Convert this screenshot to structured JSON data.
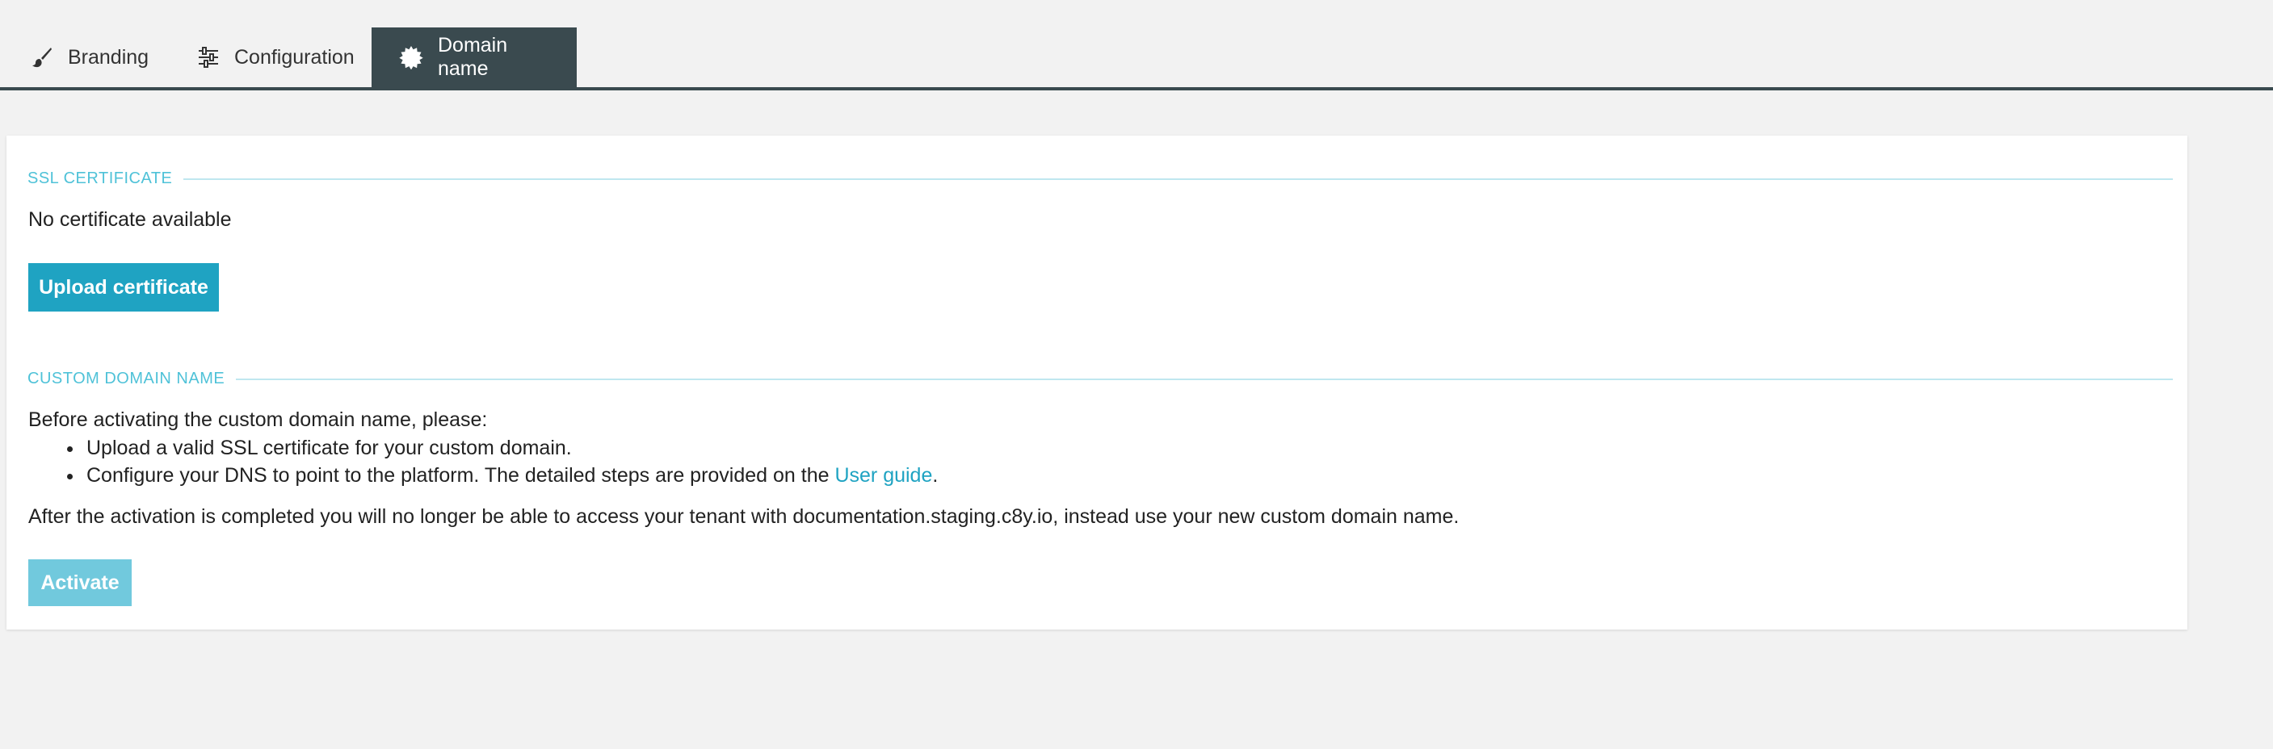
{
  "tabs": [
    {
      "label": "Branding",
      "icon": "paintbrush-icon",
      "active": false
    },
    {
      "label": "Configuration",
      "icon": "sliders-icon",
      "active": false
    },
    {
      "label": "Domain name",
      "icon": "badge-icon",
      "active": true
    }
  ],
  "ssl": {
    "title": "SSL CERTIFICATE",
    "status": "No certificate available",
    "upload_label": "Upload certificate"
  },
  "domain": {
    "title": "CUSTOM DOMAIN NAME",
    "intro": "Before activating the custom domain name, please:",
    "bullet1": "Upload a valid SSL certificate for your custom domain.",
    "bullet2_prefix": "Configure your DNS to point to the platform. The detailed steps are provided on the ",
    "bullet2_link": "User guide",
    "bullet2_suffix": ".",
    "after": "After the activation is completed you will no longer be able to access your tenant with documentation.staging.c8y.io, instead use your new custom domain name.",
    "activate_label": "Activate"
  },
  "colors": {
    "accent": "#1fa3c2",
    "tab_active_bg": "#3a4a4f",
    "section_title": "#4fc2d8",
    "activate_disabled": "#71c9dd"
  }
}
